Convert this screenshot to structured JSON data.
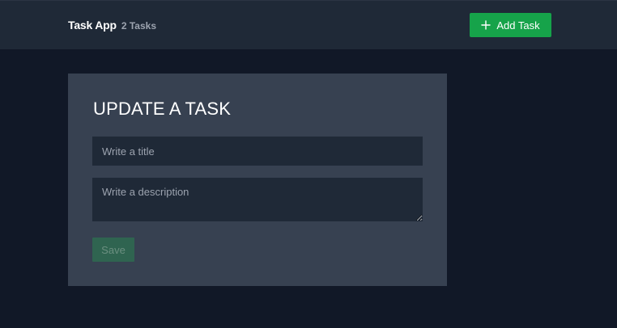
{
  "navbar": {
    "app_title": "Task App",
    "task_count": "2 Tasks",
    "add_task_label": "Add Task",
    "add_task_icon": "plus-icon"
  },
  "form": {
    "heading": "UPDATE A TASK",
    "title_placeholder": "Write a title",
    "title_value": "",
    "description_placeholder": "Write a description",
    "description_value": "",
    "save_label": "Save",
    "save_disabled": true
  },
  "colors": {
    "page_background": "#111827",
    "navbar_background": "#1f2937",
    "card_background": "#374151",
    "input_background": "#1f2937",
    "accent_green": "#16a34a",
    "disabled_green": "#2f6450",
    "muted_text": "#9ca3af"
  }
}
